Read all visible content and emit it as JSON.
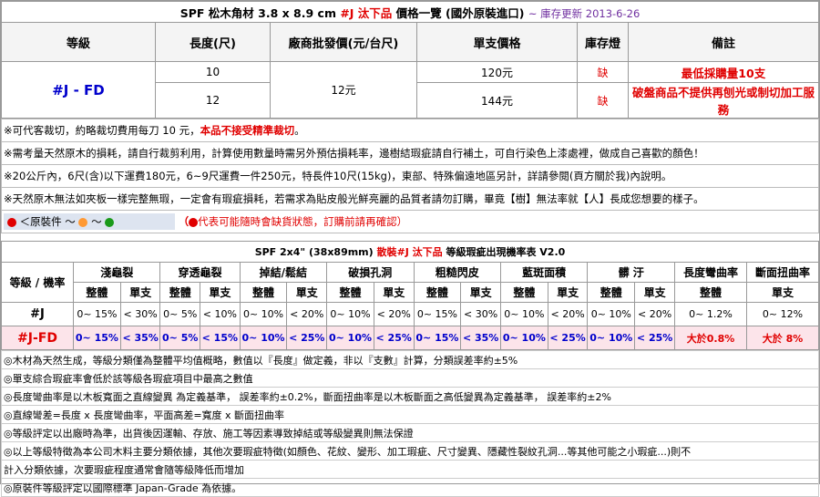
{
  "title": {
    "prefix": "SPF  松木角材 3.8 x 8.9 cm ",
    "highlight": "#J 汰下品",
    "suffix": " 價格一覽 (國外原裝進口)",
    "updated": "~ 庫存更新 2013-6-26"
  },
  "price_table": {
    "headers": [
      "等級",
      "長度(尺)",
      "廠商批發價(元/台尺)",
      "單支價格",
      "庫存燈",
      "備註"
    ],
    "grade": "#J - FD",
    "wholesale": "12元",
    "rows": [
      {
        "length": "10",
        "price": "120元",
        "stock": "缺"
      },
      {
        "length": "12",
        "price": "144元",
        "stock": "缺"
      }
    ],
    "remark1": "最低採購量10支",
    "remark2": "破盤商品不提供再刨光或制切加工服務"
  },
  "notes1": [
    {
      "a": "※可代客裁切，約略裁切費用每刀 10 元，",
      "b": "本品不接受精準裁切",
      "c": "。"
    },
    {
      "a": "※需考量天然原木的損耗，請自行裁剪利用，計算使用數量時需另外預估損耗率，邊樹結瑕疵請自行補土，可自行染色上漆處裡，做成自己喜歡的顏色！"
    },
    {
      "a": "※20公斤內，6尺(含)以下運費180元，6~9尺運費一件250元，特長件10尺(15kg)，東部、特殊偏遠地區另計，詳請參閱(頁方關於我)內說明。"
    },
    {
      "a": "※天然原木無法如夾板一樣完整無瑕，一定會有瑕疵損耗，若需求為貼皮般光鮮亮麗的品質者請勿訂購，畢竟【樹】無法率就【人】長成您想要的樣子。"
    }
  ],
  "legend": {
    "label": "＜原裝件 ～",
    "tilde": "～",
    "note": "代表可能隨時會缺貨狀態，訂購前請再確認）",
    "open": "（",
    "colors": [
      "#e00000",
      "#ff9933",
      "#1a9a1a"
    ]
  },
  "grade_table": {
    "title_prefix": "SPF 2x4\" (38x89mm) ",
    "title_red": "散裝#J 汰下品",
    "title_suffix": " 等級瑕疵出現機率表 V2.0",
    "corner": "等級 / 機率",
    "groups": [
      "淺龜裂",
      "穿透龜裂",
      "掉結/鬆結",
      "破損孔洞",
      "粗糙閃皮",
      "藍斑面積",
      "髒  汙",
      "長度彎曲率",
      "斷面扭曲率"
    ],
    "sub": [
      "整體",
      "單支"
    ],
    "rows": [
      {
        "grade": "#J",
        "values": [
          "0~ 15%",
          "< 30%",
          "0~ 5%",
          "< 10%",
          "0~ 10%",
          "< 20%",
          "0~ 10%",
          "< 20%",
          "0~ 15%",
          "< 30%",
          "0~ 10%",
          "< 20%",
          "0~ 10%",
          "< 20%",
          "0~ 1.2%",
          "0~ 12%"
        ]
      },
      {
        "grade": "#J-FD",
        "values": [
          "0~ 15%",
          "< 35%",
          "0~ 5%",
          "< 15%",
          "0~ 10%",
          "< 25%",
          "0~ 10%",
          "< 25%",
          "0~ 15%",
          "< 35%",
          "0~ 10%",
          "< 25%",
          "0~ 10%",
          "< 25%",
          "大於0.8%",
          "大於  8%"
        ]
      }
    ]
  },
  "notes2": [
    "◎木材為天然生成，等級分類僅為整體平均值概略，數值以『長度』做定義，非以『支數』計算，分類誤差率約±5%",
    "◎單支綜合瑕疵率會低於該等級各瑕疵項目中最高之數值",
    "◎長度彎曲率是以木板寬面之直線變異 為定義基準， 誤差率約±0.2%，斷面扭曲率是以木板斷面之高低變異為定義基準， 誤差率約±2%",
    "◎直線彎差=長度 x 長度彎曲率，平面高差=寬度 x 斷面扭曲率",
    "◎等級評定以出廠時為準，出貨後因運輸、存放、施工等因素導致掉結或等級變異則無法保證",
    "◎以上等級特徵為本公司木料主要分類依據，其他次要瑕疵特徵(如顏色、花紋、變形、加工瑕疵、尺寸變異、隱藏性裂紋孔洞...等其他可能之小瑕疵...)則不",
    "計入分類依據，次要瑕疵程度通常會隨等級降低而增加",
    "◎原裝件等級評定以國際標準 Japan-Grade 為依據。"
  ]
}
